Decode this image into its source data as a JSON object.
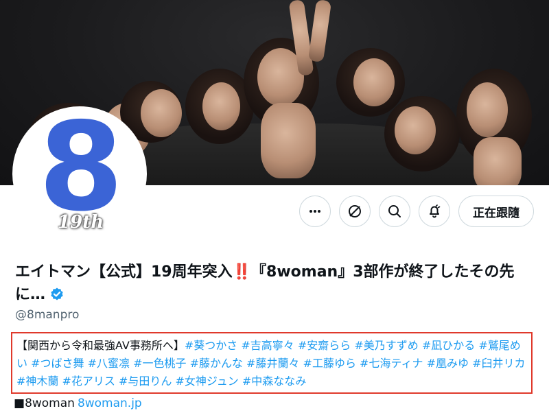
{
  "profile": {
    "display_name_prefix": "エイトマン【公式】19周年突入",
    "display_name_mark": "‼️",
    "display_name_suffix": "『8woman』3部作が終了したその先に…",
    "handle": "@8manpro",
    "avatar_numeral": "8",
    "avatar_badge": "19th"
  },
  "actions": {
    "more_label": "…",
    "follow_label": "正在跟隨"
  },
  "bio": {
    "lead": "【関西から令和最強AV事務所へ】",
    "tags": "#葵つかさ #吉高寧々 #安齋らら #美乃すずめ #凪ひかる #鷲尾めい #つばさ舞 #八蜜凛 #一色桃子 #藤かんな #藤井蘭々 #工藤ゆら #七海ティナ #凰みゆ #臼井リカ #神木蘭 #花アリス #与田りん #女神ジュン #中森ななみ"
  },
  "links": {
    "square": "■",
    "label": "8woman",
    "url_text": "8woman.jp"
  },
  "colors": {
    "accent": "#1d9bf0",
    "avatar_blue": "#3b64d6",
    "highlight_border": "#e0392b"
  },
  "icons": [
    "more-icon",
    "grok-icon",
    "search-icon",
    "notification-bell-icon",
    "verified-badge-icon"
  ]
}
